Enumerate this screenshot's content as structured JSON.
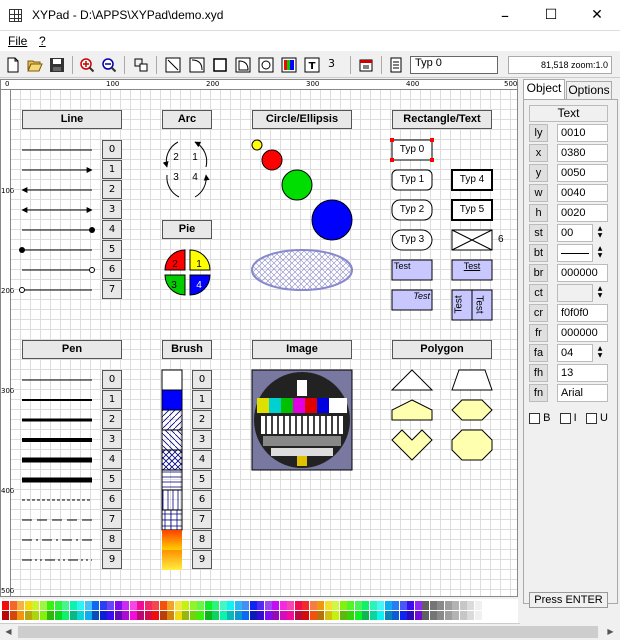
{
  "window": {
    "title": "XYPad - D:\\APPS\\XYPad\\demo.xyd",
    "minimize": "–",
    "maximize": "☐",
    "close": "✕"
  },
  "menu": {
    "file": "File",
    "help": "?"
  },
  "toolbar": {
    "layer_number": "3",
    "object_name": "Typ 0",
    "zoom_status": "81,518 zoom:1.0"
  },
  "rulers": {
    "top": [
      "0",
      "100",
      "200",
      "300",
      "400",
      "500"
    ],
    "left": [
      "100",
      "200",
      "300",
      "400",
      "500"
    ]
  },
  "sections": {
    "line": "Line",
    "arc": "Arc",
    "circle": "Circle/Ellipsis",
    "rect_text": "Rectangle/Text",
    "pie": "Pie",
    "pen": "Pen",
    "brush": "Brush",
    "image": "Image",
    "polygon": "Polygon"
  },
  "line_numbers": [
    "0",
    "1",
    "2",
    "3",
    "4",
    "5",
    "6",
    "7"
  ],
  "pen_numbers": [
    "0",
    "1",
    "2",
    "3",
    "4",
    "5",
    "6",
    "7",
    "8",
    "9"
  ],
  "brush_numbers": [
    "0",
    "1",
    "2",
    "3",
    "4",
    "5",
    "6",
    "7",
    "8",
    "9"
  ],
  "arc_labels": [
    "2",
    "1",
    "3",
    "4"
  ],
  "pie_labels": [
    "2",
    "1",
    "3",
    "4"
  ],
  "rect_labels": {
    "typ0": "Typ 0",
    "typ1": "Typ 1",
    "typ2": "Typ 2",
    "typ3": "Typ 3",
    "typ4": "Typ 4",
    "typ5": "Typ 5",
    "six": "6",
    "test1": "Test",
    "test2": "Test",
    "test3": "Test",
    "test4": "Test",
    "test5": "Test"
  },
  "panel": {
    "tabs": [
      "Object",
      "Options"
    ],
    "object_type": "Text",
    "properties": [
      {
        "label": "ly",
        "value": "0010"
      },
      {
        "label": "x",
        "value": "0380"
      },
      {
        "label": "y",
        "value": "0050"
      },
      {
        "label": "w",
        "value": "0040"
      },
      {
        "label": "h",
        "value": "0020"
      },
      {
        "label": "st",
        "value": "00"
      },
      {
        "label": "bt",
        "value": ""
      },
      {
        "label": "br",
        "value": "000000"
      },
      {
        "label": "ct",
        "value": ""
      },
      {
        "label": "cr",
        "value": "f0f0f0"
      },
      {
        "label": "fr",
        "value": "000000"
      },
      {
        "label": "fa",
        "value": "04"
      },
      {
        "label": "fh",
        "value": "13"
      },
      {
        "label": "fn",
        "value": "Arial"
      }
    ],
    "checkboxes": [
      "B",
      "I",
      "U"
    ],
    "press_enter": "Press ENTER"
  },
  "colors": {
    "red": "#ff0000",
    "yellow": "#ffff00",
    "green": "#00cc00",
    "blue": "#0000ff",
    "lightblue": "#c8c8ff",
    "polyfill": "#ffffb0"
  }
}
